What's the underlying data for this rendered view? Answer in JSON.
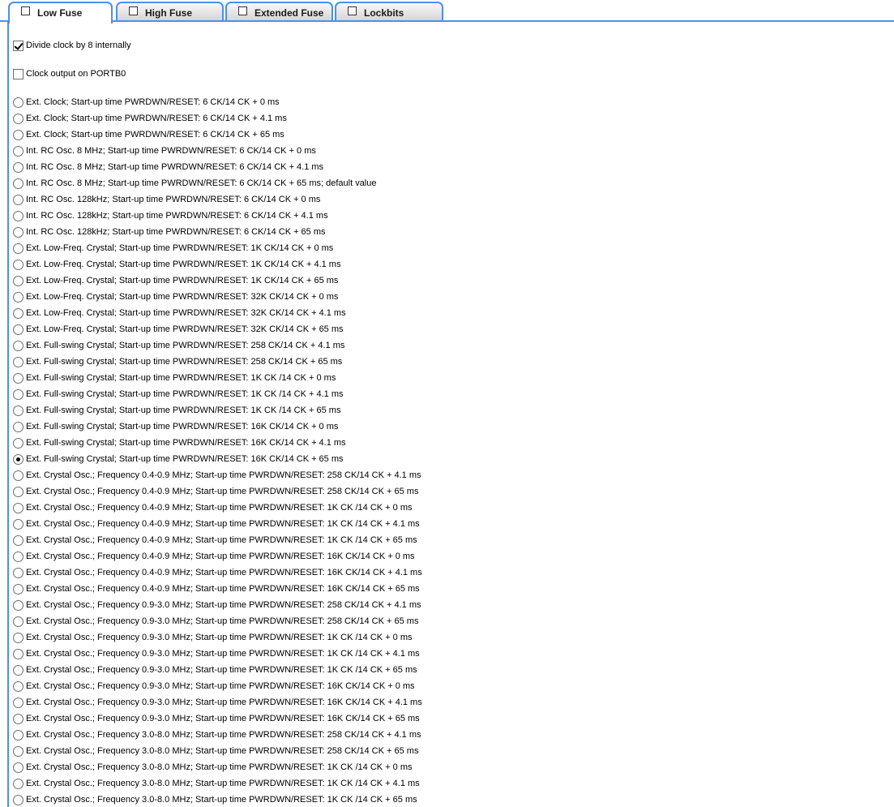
{
  "tabs": [
    {
      "label": "Low Fuse",
      "active": true
    },
    {
      "label": "High Fuse",
      "active": false
    },
    {
      "label": "Extended Fuse",
      "active": false
    },
    {
      "label": "Lockbits",
      "active": false
    }
  ],
  "checkboxes": [
    {
      "label": "Divide clock by 8 internally",
      "checked": true
    },
    {
      "label": "Clock output on PORTB0",
      "checked": false
    }
  ],
  "radio_options": [
    {
      "label": "Ext. Clock; Start-up time PWRDWN/RESET: 6 CK/14 CK + 0 ms",
      "selected": false
    },
    {
      "label": "Ext. Clock; Start-up time PWRDWN/RESET: 6 CK/14 CK + 4.1 ms",
      "selected": false
    },
    {
      "label": "Ext. Clock; Start-up time PWRDWN/RESET: 6 CK/14 CK + 65 ms",
      "selected": false
    },
    {
      "label": "Int. RC Osc. 8 MHz; Start-up time PWRDWN/RESET: 6 CK/14 CK + 0 ms",
      "selected": false
    },
    {
      "label": "Int. RC Osc. 8 MHz; Start-up time PWRDWN/RESET: 6 CK/14 CK + 4.1 ms",
      "selected": false
    },
    {
      "label": "Int. RC Osc. 8 MHz; Start-up time PWRDWN/RESET: 6 CK/14 CK + 65 ms; default value",
      "selected": false
    },
    {
      "label": "Int. RC Osc. 128kHz; Start-up time PWRDWN/RESET: 6 CK/14 CK + 0 ms",
      "selected": false
    },
    {
      "label": "Int. RC Osc. 128kHz; Start-up time PWRDWN/RESET: 6 CK/14 CK + 4.1 ms",
      "selected": false
    },
    {
      "label": "Int. RC Osc. 128kHz; Start-up time PWRDWN/RESET: 6 CK/14 CK + 65 ms",
      "selected": false
    },
    {
      "label": "Ext. Low-Freq. Crystal; Start-up time PWRDWN/RESET: 1K CK/14 CK + 0 ms",
      "selected": false
    },
    {
      "label": "Ext. Low-Freq. Crystal; Start-up time PWRDWN/RESET: 1K CK/14 CK + 4.1 ms",
      "selected": false
    },
    {
      "label": "Ext. Low-Freq. Crystal; Start-up time PWRDWN/RESET: 1K CK/14 CK + 65 ms",
      "selected": false
    },
    {
      "label": "Ext. Low-Freq. Crystal; Start-up time PWRDWN/RESET: 32K CK/14 CK + 0 ms",
      "selected": false
    },
    {
      "label": "Ext. Low-Freq. Crystal; Start-up time PWRDWN/RESET: 32K CK/14 CK + 4.1 ms",
      "selected": false
    },
    {
      "label": "Ext. Low-Freq. Crystal; Start-up time PWRDWN/RESET: 32K CK/14 CK + 65 ms",
      "selected": false
    },
    {
      "label": "Ext. Full-swing Crystal; Start-up time PWRDWN/RESET: 258 CK/14 CK + 4.1 ms",
      "selected": false
    },
    {
      "label": "Ext. Full-swing Crystal; Start-up time PWRDWN/RESET: 258 CK/14 CK + 65 ms",
      "selected": false
    },
    {
      "label": "Ext. Full-swing Crystal; Start-up time PWRDWN/RESET: 1K CK /14 CK + 0 ms",
      "selected": false
    },
    {
      "label": "Ext. Full-swing Crystal; Start-up time PWRDWN/RESET: 1K CK /14 CK + 4.1 ms",
      "selected": false
    },
    {
      "label": "Ext. Full-swing Crystal; Start-up time PWRDWN/RESET: 1K CK /14 CK + 65 ms",
      "selected": false
    },
    {
      "label": "Ext. Full-swing Crystal; Start-up time PWRDWN/RESET: 16K CK/14 CK + 0 ms",
      "selected": false
    },
    {
      "label": "Ext. Full-swing Crystal; Start-up time PWRDWN/RESET: 16K CK/14 CK + 4.1 ms",
      "selected": false
    },
    {
      "label": "Ext. Full-swing Crystal; Start-up time PWRDWN/RESET: 16K CK/14 CK + 65 ms",
      "selected": true
    },
    {
      "label": "Ext. Crystal Osc.; Frequency 0.4-0.9 MHz; Start-up time PWRDWN/RESET: 258 CK/14 CK + 4.1 ms",
      "selected": false
    },
    {
      "label": "Ext. Crystal Osc.; Frequency 0.4-0.9 MHz; Start-up time PWRDWN/RESET: 258 CK/14 CK + 65 ms",
      "selected": false
    },
    {
      "label": "Ext. Crystal Osc.; Frequency 0.4-0.9 MHz; Start-up time PWRDWN/RESET: 1K CK /14 CK + 0 ms",
      "selected": false
    },
    {
      "label": "Ext. Crystal Osc.; Frequency 0.4-0.9 MHz; Start-up time PWRDWN/RESET: 1K CK /14 CK + 4.1 ms",
      "selected": false
    },
    {
      "label": "Ext. Crystal Osc.; Frequency 0.4-0.9 MHz; Start-up time PWRDWN/RESET: 1K CK /14 CK + 65 ms",
      "selected": false
    },
    {
      "label": "Ext. Crystal Osc.; Frequency 0.4-0.9 MHz; Start-up time PWRDWN/RESET: 16K CK/14 CK + 0 ms",
      "selected": false
    },
    {
      "label": "Ext. Crystal Osc.; Frequency 0.4-0.9 MHz; Start-up time PWRDWN/RESET: 16K CK/14 CK + 4.1 ms",
      "selected": false
    },
    {
      "label": "Ext. Crystal Osc.; Frequency 0.4-0.9 MHz; Start-up time PWRDWN/RESET: 16K CK/14 CK + 65 ms",
      "selected": false
    },
    {
      "label": "Ext. Crystal Osc.; Frequency 0.9-3.0 MHz; Start-up time PWRDWN/RESET: 258 CK/14 CK + 4.1 ms",
      "selected": false
    },
    {
      "label": "Ext. Crystal Osc.; Frequency 0.9-3.0 MHz; Start-up time PWRDWN/RESET: 258 CK/14 CK + 65 ms",
      "selected": false
    },
    {
      "label": "Ext. Crystal Osc.; Frequency 0.9-3.0 MHz; Start-up time PWRDWN/RESET: 1K CK /14 CK + 0 ms",
      "selected": false
    },
    {
      "label": "Ext. Crystal Osc.; Frequency 0.9-3.0 MHz; Start-up time PWRDWN/RESET: 1K CK /14 CK + 4.1 ms",
      "selected": false
    },
    {
      "label": "Ext. Crystal Osc.; Frequency 0.9-3.0 MHz; Start-up time PWRDWN/RESET: 1K CK /14 CK + 65 ms",
      "selected": false
    },
    {
      "label": "Ext. Crystal Osc.; Frequency 0.9-3.0 MHz; Start-up time PWRDWN/RESET: 16K CK/14 CK + 0 ms",
      "selected": false
    },
    {
      "label": "Ext. Crystal Osc.; Frequency 0.9-3.0 MHz; Start-up time PWRDWN/RESET: 16K CK/14 CK + 4.1 ms",
      "selected": false
    },
    {
      "label": "Ext. Crystal Osc.; Frequency 0.9-3.0 MHz; Start-up time PWRDWN/RESET: 16K CK/14 CK + 65 ms",
      "selected": false
    },
    {
      "label": "Ext. Crystal Osc.; Frequency 3.0-8.0 MHz; Start-up time PWRDWN/RESET: 258 CK/14 CK + 4.1 ms",
      "selected": false
    },
    {
      "label": "Ext. Crystal Osc.; Frequency 3.0-8.0 MHz; Start-up time PWRDWN/RESET: 258 CK/14 CK + 65 ms",
      "selected": false
    },
    {
      "label": "Ext. Crystal Osc.; Frequency 3.0-8.0 MHz; Start-up time PWRDWN/RESET: 1K CK /14 CK + 0 ms",
      "selected": false
    },
    {
      "label": "Ext. Crystal Osc.; Frequency 3.0-8.0 MHz; Start-up time PWRDWN/RESET: 1K CK /14 CK + 4.1 ms",
      "selected": false
    },
    {
      "label": "Ext. Crystal Osc.; Frequency 3.0-8.0 MHz; Start-up time PWRDWN/RESET: 1K CK /14 CK + 65 ms",
      "selected": false
    }
  ]
}
